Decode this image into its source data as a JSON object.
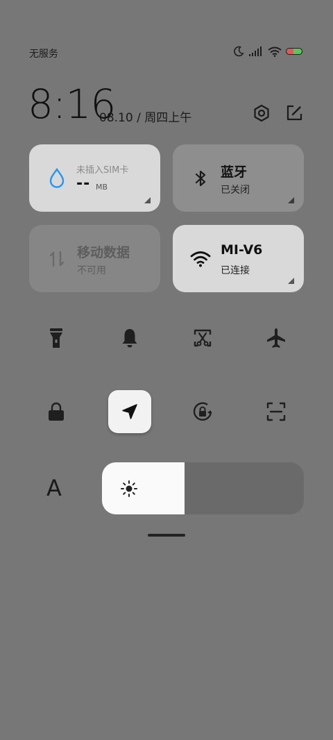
{
  "status_bar": {
    "carrier": "无服务"
  },
  "header": {
    "time": "8:16",
    "date": "08.10 / 周四上午"
  },
  "tiles": {
    "data_usage": {
      "label": "未插入SIM卡",
      "value": "--",
      "unit": "MB"
    },
    "bluetooth": {
      "title": "蓝牙",
      "status": "已关闭"
    },
    "mobile_data": {
      "title": "移动数据",
      "status": "不可用"
    },
    "wifi": {
      "title": "MI-V6",
      "status": "已连接"
    }
  },
  "toggles": {
    "row1": [
      "flashlight-icon",
      "bell-icon",
      "screenshot-icon",
      "airplane-icon"
    ],
    "row2": [
      "lock-icon",
      "location-icon",
      "rotation-lock-icon",
      "scan-icon"
    ]
  },
  "brightness": {
    "level": 0.41,
    "font_label": "A"
  },
  "colors": {
    "background": "#777777",
    "tile_light": "#d9d9d9",
    "tile_dim": "#868686",
    "accent_blue": "#2196f3"
  }
}
